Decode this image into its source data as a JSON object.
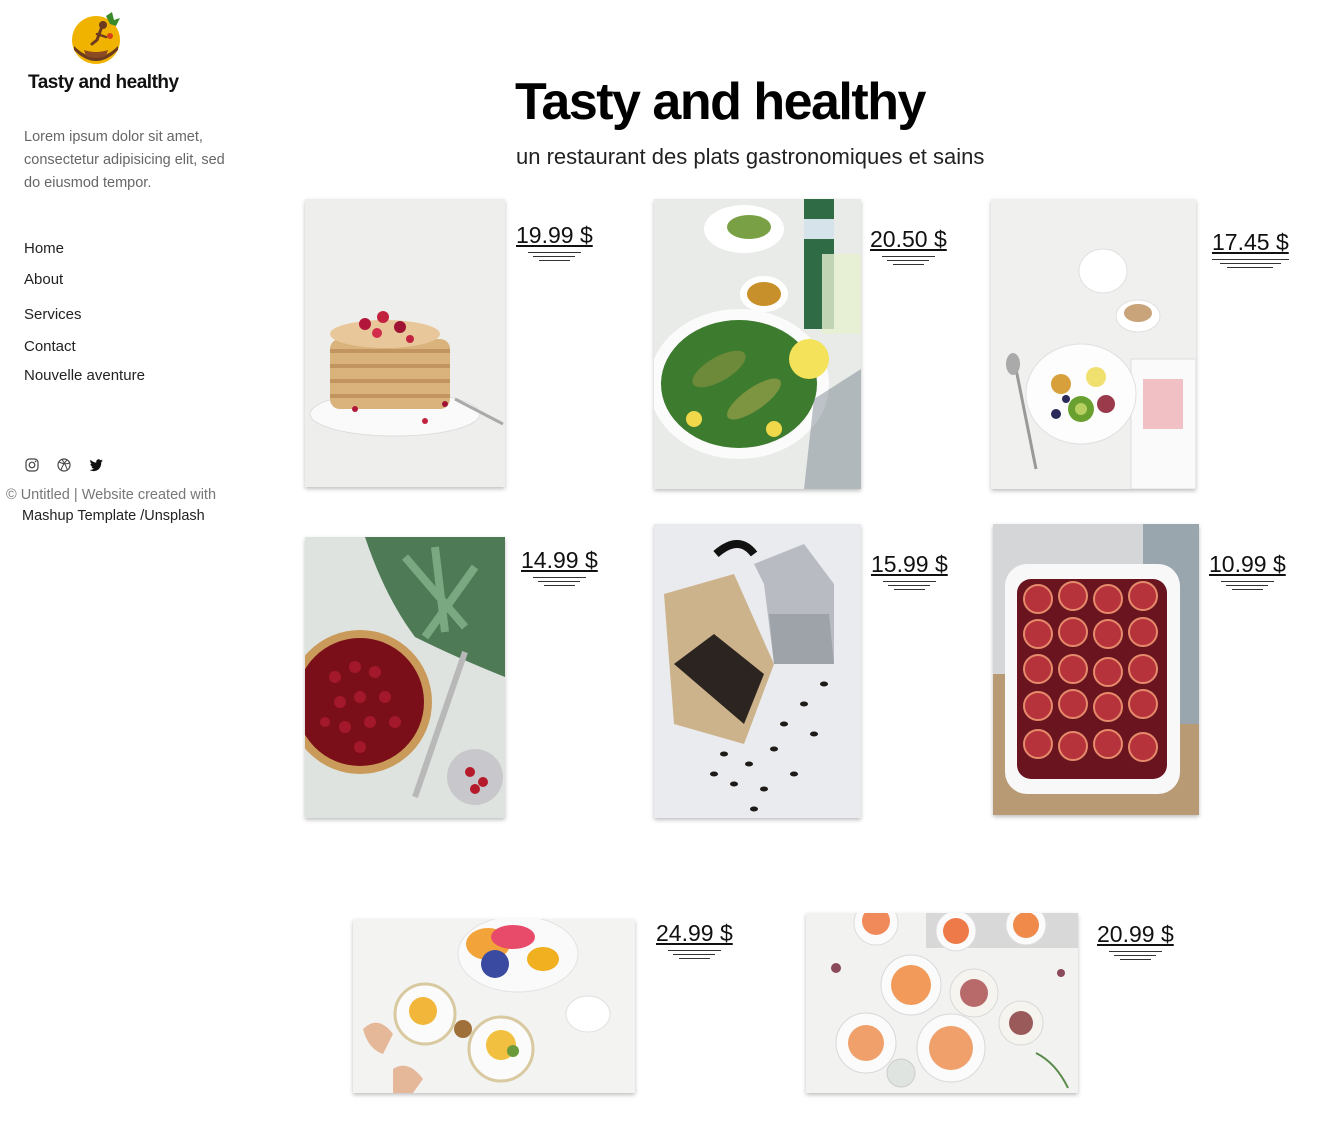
{
  "brand": {
    "name": "Tasty and healthy",
    "logo_icon": "chef-cooking-logo-icon"
  },
  "sidebar": {
    "intro": "Lorem ipsum dolor sit amet, consectetur adipisicing elit, sed do eiusmod tempor.",
    "nav": [
      {
        "label": "Home"
      },
      {
        "label": "About"
      },
      {
        "label": "Services"
      },
      {
        "label": "Contact"
      },
      {
        "label": "Nouvelle aventure"
      }
    ],
    "social_icons": [
      "instagram-icon",
      "dribbble-icon",
      "twitter-icon"
    ],
    "copyright": "© Untitled | Website created with",
    "credits": "Mashup Template /Unsplash"
  },
  "header": {
    "title": "Tasty and healthy",
    "subtitle": "un restaurant des plats gastronomiques et sains"
  },
  "menu": {
    "items": [
      {
        "price": "19.99 $",
        "photo": "pancakes-photo"
      },
      {
        "price": "20.50 $",
        "photo": "salad-bowl-photo"
      },
      {
        "price": "17.45 $",
        "photo": "fruit-yogurt-bowl-photo"
      },
      {
        "price": "14.99 $",
        "photo": "berry-tart-photo"
      },
      {
        "price": "15.99 $",
        "photo": "coffee-beans-photo"
      },
      {
        "price": "10.99 $",
        "photo": "baked-plums-photo"
      },
      {
        "price": "24.99 $",
        "photo": "brunch-table-photo"
      },
      {
        "price": "20.99 $",
        "photo": "grapefruit-dishes-photo"
      }
    ]
  },
  "colors": {
    "logo_yellow": "#f0b400",
    "logo_brown": "#6b3a1f",
    "text_muted": "#666666"
  }
}
